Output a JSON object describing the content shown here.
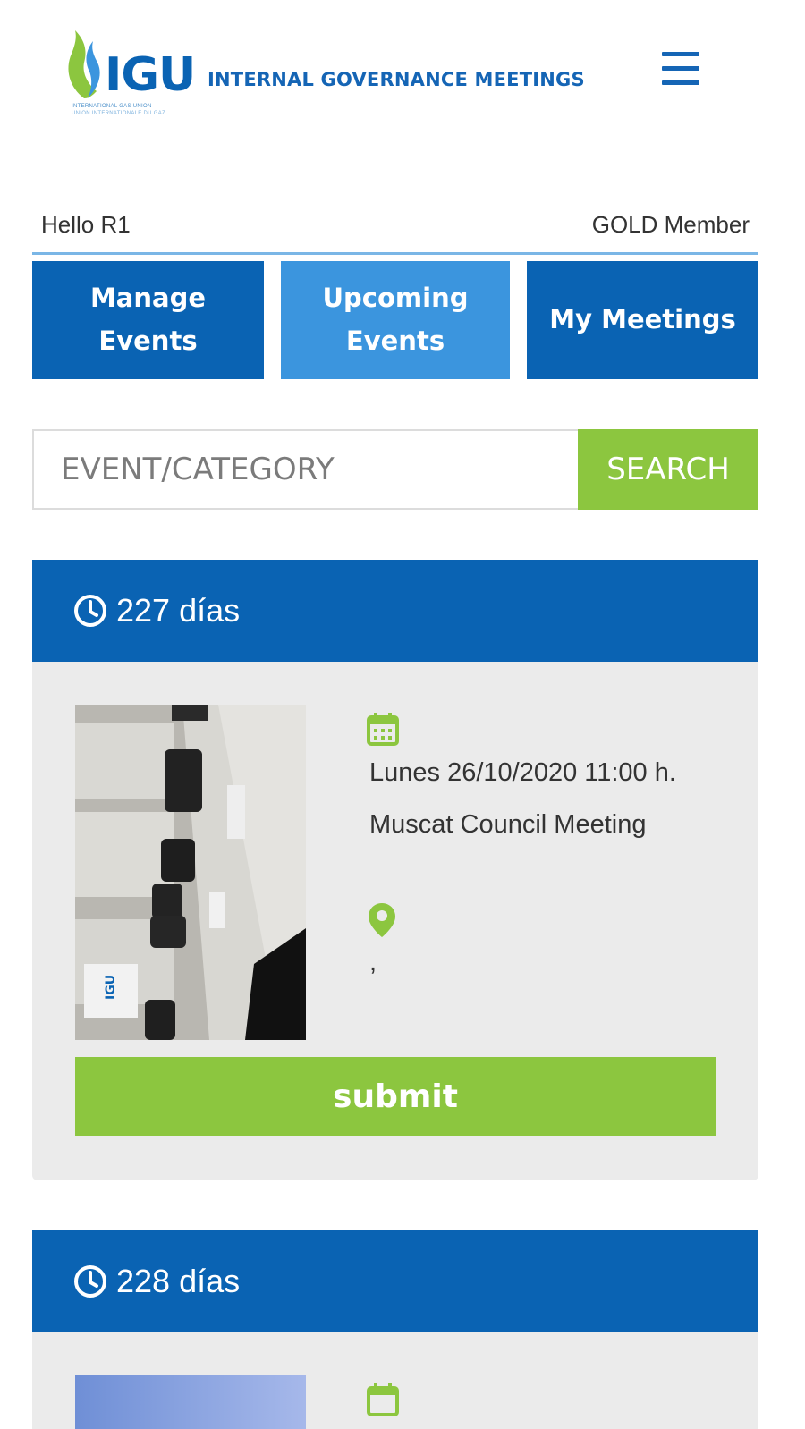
{
  "header": {
    "logo_text": "IGU",
    "logo_subtitle_1": "INTERNATIONAL GAS UNION",
    "logo_subtitle_2": "UNION INTERNATIONALE DU GAZ",
    "title": "INTERNAL GOVERNANCE MEETINGS",
    "menu_icon": "hamburger-menu-icon"
  },
  "user": {
    "greeting": "Hello R1",
    "membership": "GOLD Member"
  },
  "nav": {
    "manage_events": "Manage Events",
    "upcoming_events": "Upcoming Events",
    "my_meetings": "My Meetings"
  },
  "search": {
    "placeholder": "EVENT/CATEGORY",
    "button_label": "SEARCH"
  },
  "events": [
    {
      "countdown": "227 días",
      "date": "Lunes 26/10/2020 11:00 h.",
      "title": "Muscat Council Meeting",
      "location": ",",
      "submit_label": "submit"
    },
    {
      "countdown": "228 días"
    }
  ],
  "colors": {
    "primary_blue": "#0a63b3",
    "active_blue": "#3b95de",
    "accent_green": "#8cc63f",
    "card_bg": "#ebebeb"
  }
}
